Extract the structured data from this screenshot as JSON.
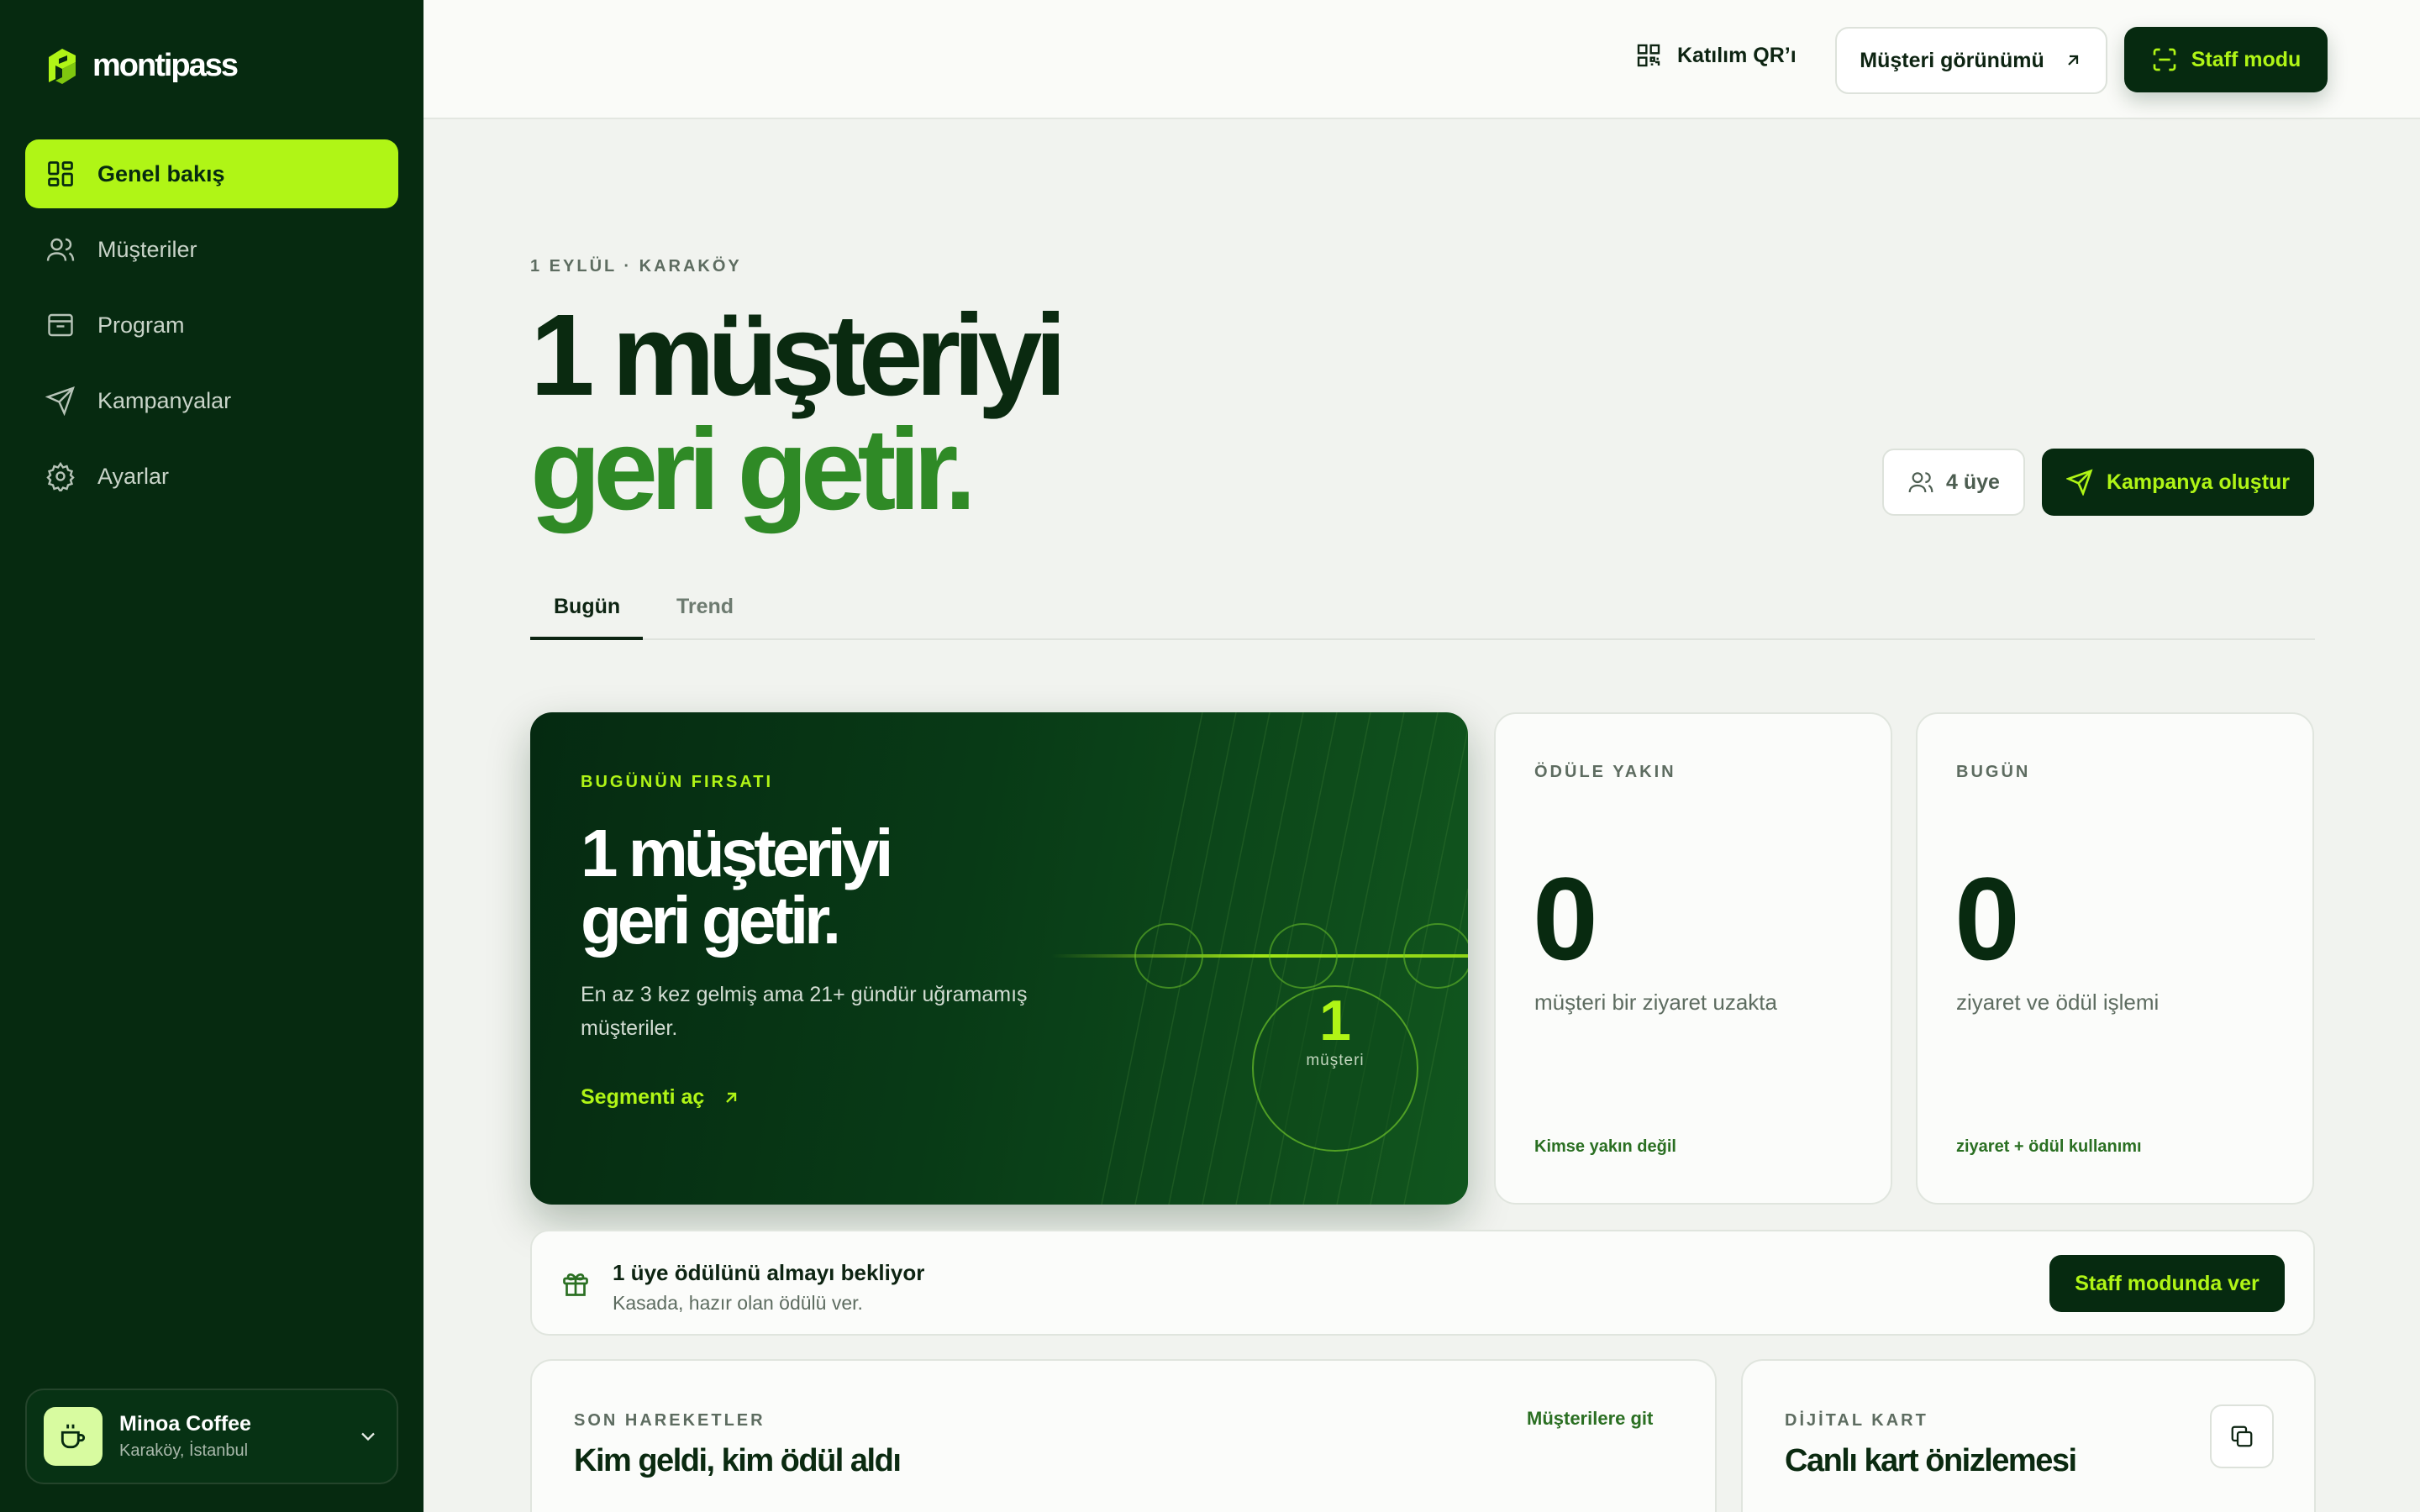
{
  "colors": {
    "sidebar_bg": "#062a10",
    "accent": "#b0f516",
    "headline_green": "#2f8a26",
    "page_bg": "#f1f3ef"
  },
  "brand": {
    "name": "montipass",
    "icon": "montipass-logo-icon"
  },
  "sidebar": {
    "items": [
      {
        "label": "Genel bakış",
        "icon": "dashboard-grid-icon",
        "active": true
      },
      {
        "label": "Müşteriler",
        "icon": "users-icon",
        "active": false
      },
      {
        "label": "Program",
        "icon": "inbox-icon",
        "active": false
      },
      {
        "label": "Kampanyalar",
        "icon": "send-icon",
        "active": false
      },
      {
        "label": "Ayarlar",
        "icon": "gear-icon",
        "active": false
      }
    ],
    "shop": {
      "name": "Minoa Coffee",
      "location": "Karaköy, İstanbul",
      "icon": "coffee-cup-icon"
    }
  },
  "topbar": {
    "qr_label": "Katılım QR’ı",
    "customer_view_label": "Müşteri görünümü",
    "staff_mode_label": "Staff modu"
  },
  "hero": {
    "eyebrow": "1 EYLÜL · KARAKÖY",
    "title_line1": "1 müşteriyi",
    "title_line2": "geri getir.",
    "members_label": "4 üye",
    "campaign_button": "Kampanya oluştur"
  },
  "tabs": [
    {
      "label": "Bugün",
      "active": true
    },
    {
      "label": "Trend",
      "active": false
    }
  ],
  "opportunity": {
    "eyebrow": "BUGÜNÜN FIRSATI",
    "title_line1": "1 müşteriyi",
    "title_line2": "geri getir.",
    "description": "En az 3 kez gelmiş ama 21+ gündür uğramamış müşteriler.",
    "link_label": "Segmenti aç",
    "count": "1",
    "count_label": "müşteri"
  },
  "stats": [
    {
      "eyebrow": "ÖDÜLE YAKIN",
      "value": "0",
      "label": "müşteri bir ziyaret uzakta",
      "footer": "Kimse yakın değil"
    },
    {
      "eyebrow": "BUGÜN",
      "value": "0",
      "label": "ziyaret ve ödül işlemi",
      "footer": "ziyaret + ödül kullanımı"
    }
  ],
  "reward_banner": {
    "title": "1 üye ödülünü almayı bekliyor",
    "subtitle": "Kasada, hazır olan ödülü ver.",
    "button": "Staff modunda ver"
  },
  "activity_card": {
    "eyebrow": "SON HAREKETLER",
    "title": "Kim geldi, kim ödül aldı",
    "link": "Müşterilere git"
  },
  "digital_card": {
    "eyebrow": "DİJİTAL KART",
    "title": "Canlı kart önizlemesi"
  }
}
